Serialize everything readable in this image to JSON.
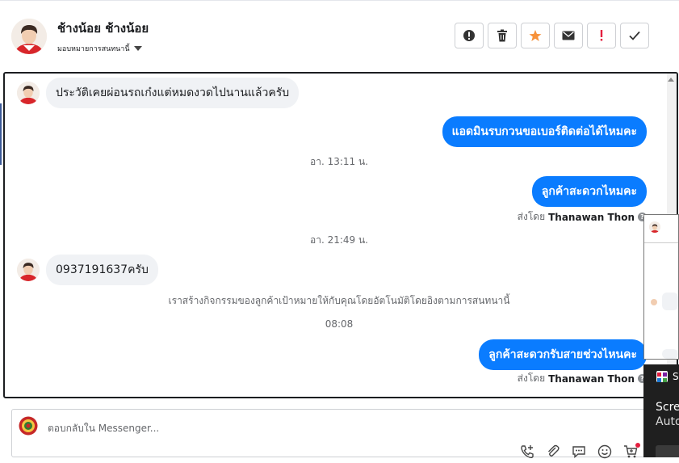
{
  "header": {
    "contact_name": "ช้างน้อย ช้างน้อย",
    "assign_label": "มอบหมายการสนทนานี้",
    "tools": [
      {
        "icon": "exclamation-circle-icon"
      },
      {
        "icon": "trash-icon"
      },
      {
        "icon": "star-icon",
        "color": "#f7923a"
      },
      {
        "icon": "envelope-icon"
      },
      {
        "icon": "exclamation-icon",
        "color": "#e41e3f"
      },
      {
        "icon": "check-icon"
      }
    ]
  },
  "conversation": {
    "msg1": "ประวัติเคยผ่อนรถเก๋งแต่หมดงวดไปนานแล้วครับ",
    "msg2": "แอดมินรบกวนขอเบอร์ติดต่อได้ไหมคะ",
    "ts1": "อา. 13:11 น.",
    "msg3": "ลูกค้าสะดวกไหมคะ",
    "sent_by_1_label": "ส่งโดย",
    "sent_by_1_name": "Thanawan Thon",
    "ts2": "อา. 21:49 น.",
    "msg4": "0937191637ครับ",
    "system_note": "เราสร้างกิจกรรมของลูกค้าเป้าหมายให้กับคุณโดยอัตโนมัติโดยอิงตามการสนทนานี้",
    "ts3": "08:08",
    "msg5": "ลูกค้าสะดวกรับสายช่วงไหนคะ",
    "sent_by_2_label": "ส่งโดย",
    "sent_by_2_name": "Thanawan Thon",
    "outgoing_color": "#0a7cff"
  },
  "composer": {
    "placeholder": "ตอบกลับใน Messenger...",
    "icons": [
      "phone-add-icon",
      "attachment-icon",
      "saved-reply-icon",
      "emoji-icon",
      "cart-icon"
    ]
  },
  "overlay": {
    "s_label": "S",
    "title": "Scre",
    "subtitle": "Auto"
  }
}
